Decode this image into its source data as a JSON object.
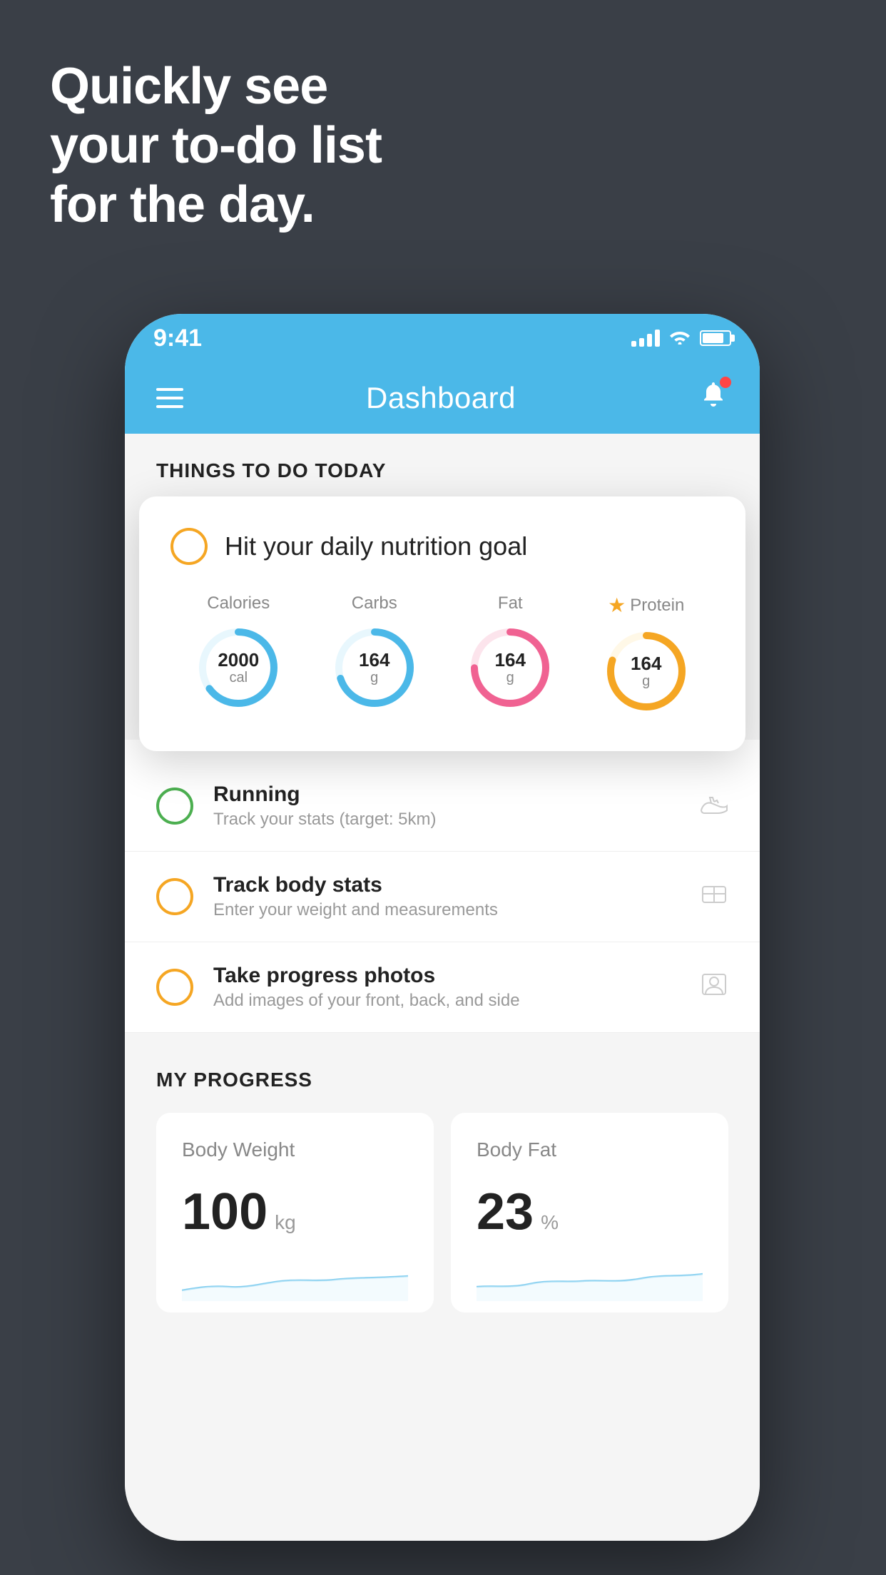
{
  "hero": {
    "line1": "Quickly see",
    "line2": "your to-do list",
    "line3": "for the day."
  },
  "status_bar": {
    "time": "9:41"
  },
  "header": {
    "title": "Dashboard"
  },
  "things_section": {
    "title": "THINGS TO DO TODAY"
  },
  "nutrition_card": {
    "check_label": "circle-check",
    "title": "Hit your daily nutrition goal",
    "macros": [
      {
        "label": "Calories",
        "value": "2000",
        "unit": "cal",
        "color": "#4bb8e8",
        "track_color": "#e8f7fd",
        "percent": 65
      },
      {
        "label": "Carbs",
        "value": "164",
        "unit": "g",
        "color": "#4bb8e8",
        "track_color": "#e8f7fd",
        "percent": 70
      },
      {
        "label": "Fat",
        "value": "164",
        "unit": "g",
        "color": "#f06292",
        "track_color": "#fce4ec",
        "percent": 75
      },
      {
        "label": "Protein",
        "value": "164",
        "unit": "g",
        "color": "#f5a623",
        "track_color": "#fff8e7",
        "percent": 80,
        "star": true
      }
    ]
  },
  "todo_items": [
    {
      "id": "running",
      "title": "Running",
      "subtitle": "Track your stats (target: 5km)",
      "circle_color": "green",
      "icon": "shoe"
    },
    {
      "id": "body-stats",
      "title": "Track body stats",
      "subtitle": "Enter your weight and measurements",
      "circle_color": "yellow",
      "icon": "scale"
    },
    {
      "id": "progress-photos",
      "title": "Take progress photos",
      "subtitle": "Add images of your front, back, and side",
      "circle_color": "yellow",
      "icon": "person"
    }
  ],
  "progress_section": {
    "title": "MY PROGRESS",
    "cards": [
      {
        "id": "body-weight",
        "title": "Body Weight",
        "value": "100",
        "unit": "kg"
      },
      {
        "id": "body-fat",
        "title": "Body Fat",
        "value": "23",
        "unit": "%"
      }
    ]
  }
}
